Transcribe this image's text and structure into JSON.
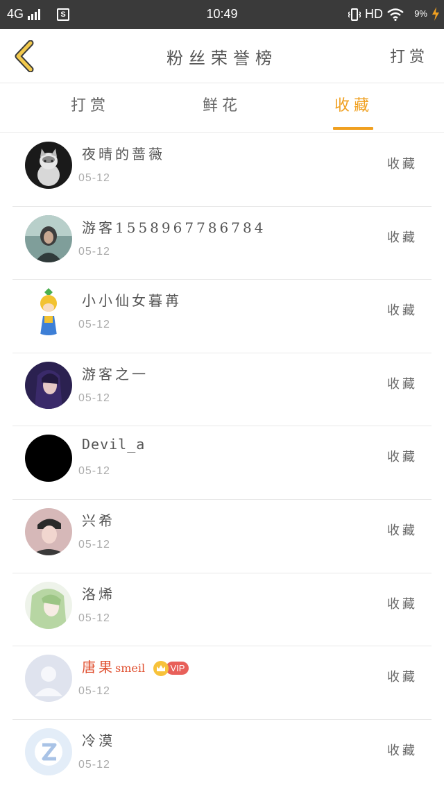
{
  "status_bar": {
    "network": "4G",
    "time": "10:49",
    "hd": "HD",
    "battery": "9%",
    "s_icon": "S"
  },
  "header": {
    "title": "粉丝荣誉榜",
    "action": "打赏"
  },
  "tabs": [
    {
      "label": "打赏",
      "active": false
    },
    {
      "label": "鲜花",
      "active": false
    },
    {
      "label": "收藏",
      "active": true
    }
  ],
  "colors": {
    "accent": "#f0a020",
    "vip_name": "#e05030",
    "status_bar_bg": "#3a3a3a"
  },
  "items": [
    {
      "name": "夜晴的蔷薇",
      "date": "05-12",
      "action": "收藏",
      "avatar": "cat-photo"
    },
    {
      "name": "游客1558967786784",
      "date": "05-12",
      "action": "收藏",
      "avatar": "person-photo"
    },
    {
      "name": "小小仙女暮苒",
      "date": "05-12",
      "action": "收藏",
      "avatar": "cartoon-girl"
    },
    {
      "name": "游客之一",
      "date": "05-12",
      "action": "收藏",
      "avatar": "anime-girl"
    },
    {
      "name": "Devil_a",
      "date": "05-12",
      "action": "收藏",
      "avatar": "black-circle"
    },
    {
      "name": "兴希",
      "date": "05-12",
      "action": "收藏",
      "avatar": "person-cap"
    },
    {
      "name": "洛烯",
      "date": "05-12",
      "action": "收藏",
      "avatar": "anime-green-hair"
    },
    {
      "name": "唐果",
      "name_suffix": "smeil",
      "vip_label": "VIP",
      "date": "05-12",
      "action": "收藏",
      "avatar": "default-silhouette"
    },
    {
      "name": "冷漠",
      "date": "05-12",
      "action": "收藏",
      "avatar": "qq-logo"
    }
  ]
}
